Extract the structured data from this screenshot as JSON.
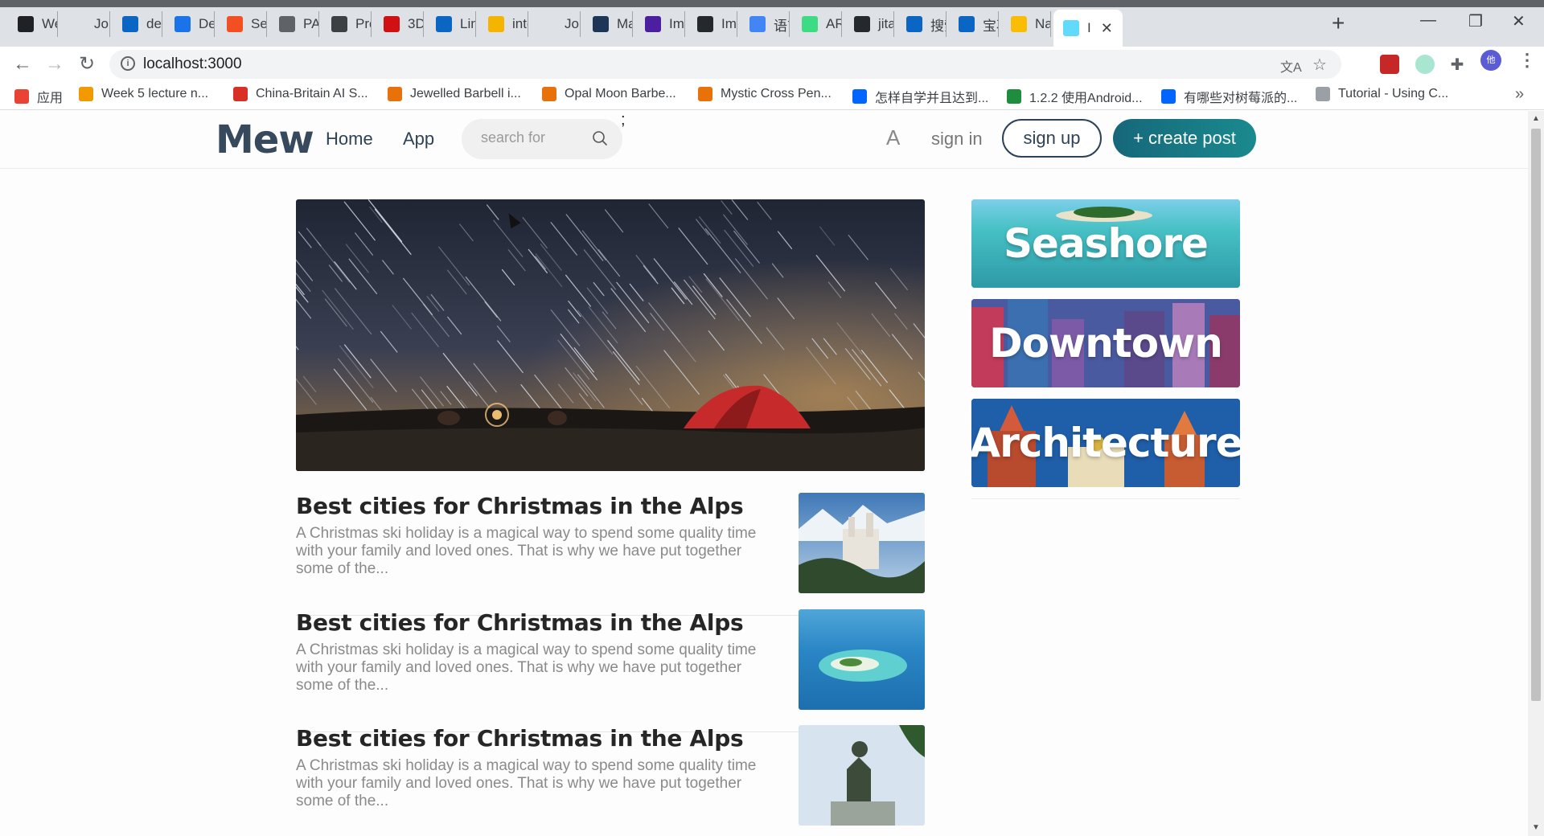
{
  "browser": {
    "tabs": [
      {
        "label": "Wel",
        "icon": "spade-icon",
        "color": "#202124"
      },
      {
        "label": "Job",
        "icon": "blank-icon",
        "color": "#dee1e6"
      },
      {
        "label": "des",
        "icon": "linkedin-icon",
        "color": "#0a66c2"
      },
      {
        "label": "Des",
        "icon": "figure-icon",
        "color": "#1a73e8"
      },
      {
        "label": "Sea",
        "icon": "microsoft-icon",
        "color": "#f25022"
      },
      {
        "label": "PA",
        "icon": "globe-icon",
        "color": "#5f6368"
      },
      {
        "label": "Pro",
        "icon": "fb-icon",
        "color": "#3c4043"
      },
      {
        "label": "3D",
        "icon": "lego-icon",
        "color": "#d01012"
      },
      {
        "label": "Link",
        "icon": "linkedin-icon",
        "color": "#0a66c2"
      },
      {
        "label": "inte",
        "icon": "hand-icon",
        "color": "#f4b400"
      },
      {
        "label": "Job",
        "icon": "blank-icon",
        "color": "#dee1e6"
      },
      {
        "label": "Mar",
        "icon": "bookmark-icon",
        "color": "#1d3557"
      },
      {
        "label": "Imp",
        "icon": "i-icon",
        "color": "#4b1fa0"
      },
      {
        "label": "Imp",
        "icon": "github-icon",
        "color": "#24292e"
      },
      {
        "label": "语言",
        "icon": "translate-icon",
        "color": "#4285f4"
      },
      {
        "label": "ARM",
        "icon": "android-icon",
        "color": "#3ddc84"
      },
      {
        "label": "jitac",
        "icon": "github-icon",
        "color": "#24292e"
      },
      {
        "label": "搜索",
        "icon": "linkedin-icon",
        "color": "#0a66c2"
      },
      {
        "label": "宝石",
        "icon": "linkedin-icon",
        "color": "#0a66c2"
      },
      {
        "label": "Nat",
        "icon": "note-icon",
        "color": "#fbbc04"
      },
      {
        "label": "I",
        "icon": "react-icon",
        "color": "#61dafb",
        "active": true
      }
    ],
    "url": "localhost:3000",
    "bookmarks": [
      {
        "label": "应用",
        "color": "#ea4335"
      },
      {
        "label": "Week 5 lecture n...",
        "color": "#f29900"
      },
      {
        "label": "China-Britain AI S...",
        "color": "#d93025"
      },
      {
        "label": "Jewelled Barbell i...",
        "color": "#e8710a"
      },
      {
        "label": "Opal Moon Barbe...",
        "color": "#e8710a"
      },
      {
        "label": "Mystic Cross Pen...",
        "color": "#e8710a"
      },
      {
        "label": "怎样自学并且达到...",
        "color": "#0066ff"
      },
      {
        "label": "1.2.2 使用Android...",
        "color": "#1e8e3e"
      },
      {
        "label": "有哪些对树莓派的...",
        "color": "#0066ff"
      },
      {
        "label": "Tutorial - Using C...",
        "color": "#9aa0a6"
      }
    ],
    "bookmarks_more": "»",
    "profile_initial": "他"
  },
  "site": {
    "logo": "Mew",
    "nav": {
      "home": "Home",
      "app": "App"
    },
    "search_placeholder": "search for",
    "stray_text": ";",
    "font_toggle": "A",
    "sign_in": "sign in",
    "sign_up": "sign up",
    "create_post": "+ create post"
  },
  "articles": [
    {
      "title": "Best cities for Christmas in the Alps",
      "excerpt": "A Christmas ski holiday is a magical way to spend some quality time with your family and loved ones. That is why we have put together some of the...",
      "thumb": "castle"
    },
    {
      "title": "Best cities for Christmas in the Alps",
      "excerpt": "A Christmas ski holiday is a magical way to spend some quality time with your family and loved ones. That is why we have put together some of the...",
      "thumb": "island"
    },
    {
      "title": "Best cities for Christmas in the Alps",
      "excerpt": "A Christmas ski holiday is a magical way to spend some quality time with your family and loved ones. That is why we have put together some of the...",
      "thumb": "statue"
    }
  ],
  "categories": [
    {
      "label": "Seashore",
      "color": "#3fb9c2"
    },
    {
      "label": "Downtown",
      "color": "#4a5aa0"
    },
    {
      "label": "Architecture",
      "color": "#1f5ea8"
    }
  ]
}
